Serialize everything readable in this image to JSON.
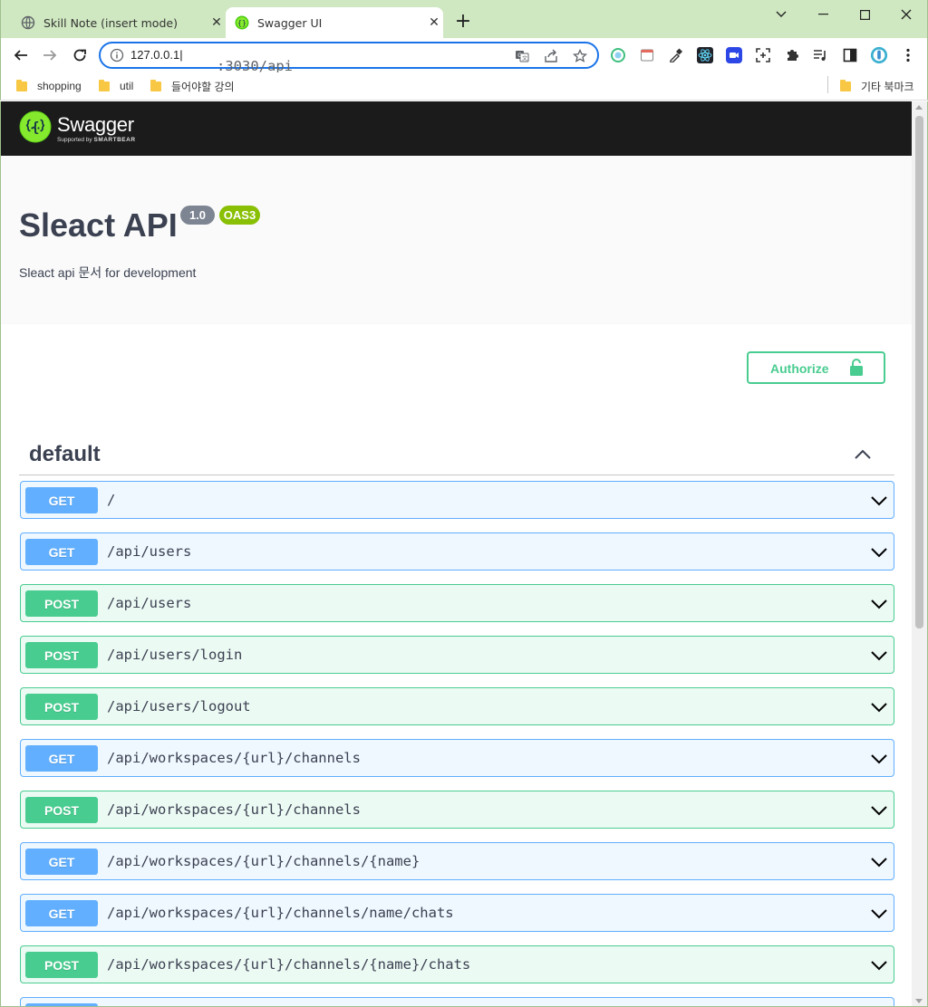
{
  "browser": {
    "tabs": [
      {
        "title": "Skill Note (insert mode)",
        "icon": "globe-icon",
        "active": false
      },
      {
        "title": "Swagger UI",
        "icon": "swagger-favicon-icon",
        "active": true
      }
    ],
    "address_host": "127.0.0.1",
    "address_rest": ":3030/api",
    "bookmarks": [
      {
        "label": "shopping",
        "icon": "folder-icon"
      },
      {
        "label": "util",
        "icon": "folder-icon"
      },
      {
        "label": "들어야할 강의",
        "icon": "folder-icon"
      }
    ],
    "other_bookmarks": "기타 북마크",
    "colors": {
      "tabstrip": "#cfe8c1",
      "focus_ring": "#1a73e8"
    }
  },
  "swagger": {
    "logo_name": "Swagger",
    "logo_sub_prefix": "Supported by",
    "logo_sub_brand": "SMARTBEAR",
    "title": "Sleact API",
    "version": "1.0",
    "oas": "OAS3",
    "description": "Sleact api 문서 for development",
    "authorize_label": "Authorize",
    "tag": "default",
    "colors": {
      "get": "#61affe",
      "post": "#49cc90",
      "topbar": "#1b1b1b",
      "version_badge": "#7d8492",
      "oas_badge": "#89bf04"
    },
    "operations": [
      {
        "method": "GET",
        "path": "/"
      },
      {
        "method": "GET",
        "path": "/api/users"
      },
      {
        "method": "POST",
        "path": "/api/users"
      },
      {
        "method": "POST",
        "path": "/api/users/login"
      },
      {
        "method": "POST",
        "path": "/api/users/logout"
      },
      {
        "method": "GET",
        "path": "/api/workspaces/{url}/channels"
      },
      {
        "method": "POST",
        "path": "/api/workspaces/{url}/channels"
      },
      {
        "method": "GET",
        "path": "/api/workspaces/{url}/channels/{name}"
      },
      {
        "method": "GET",
        "path": "/api/workspaces/{url}/channels/name/chats"
      },
      {
        "method": "POST",
        "path": "/api/workspaces/{url}/channels/{name}/chats"
      }
    ]
  }
}
